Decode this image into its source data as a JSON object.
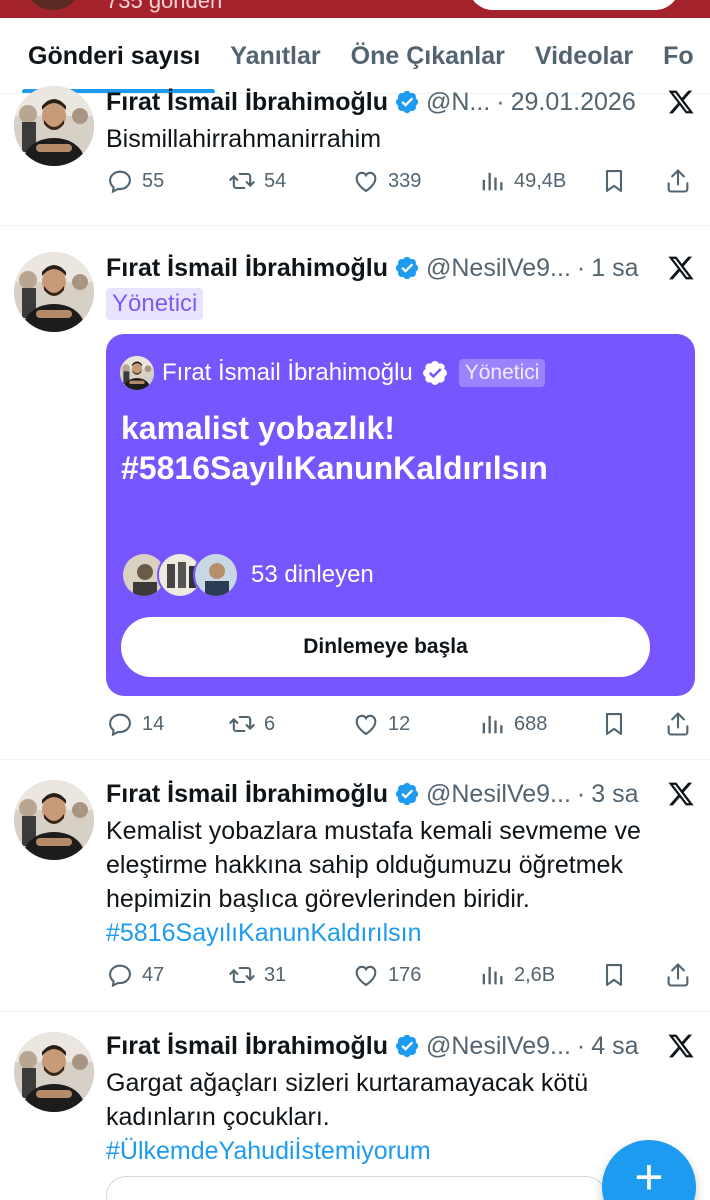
{
  "profile_header": {
    "post_count_partial": "735 gönderi"
  },
  "tabs": [
    {
      "label": "Gönderi sayısı",
      "active": true
    },
    {
      "label": "Yanıtlar",
      "active": false
    },
    {
      "label": "Öne Çıkanlar",
      "active": false
    },
    {
      "label": "Videolar",
      "active": false
    },
    {
      "label": "Fo",
      "active": false
    }
  ],
  "tweets": [
    {
      "name": "Fırat İsmail İbrahimoğlu",
      "handle": "@N...",
      "time": "29.01.2026",
      "text": "Bismillahirrahmanirrahim",
      "replies": "55",
      "retweets": "54",
      "likes": "339",
      "views": "49,4B"
    },
    {
      "name": "Fırat İsmail İbrahimoğlu",
      "handle": "@NesilVe9...",
      "time": "1 sa",
      "role": "Yönetici",
      "space": {
        "host_name": "Fırat İsmail İbrahimoğlu",
        "host_role": "Yönetici",
        "title_line1": "kamalist yobazlık!",
        "title_line2": "#5816SayılıKanunKaldırılsın",
        "listeners": "53 dinleyen",
        "button": "Dinlemeye başla",
        "color": "#7856ff"
      },
      "replies": "14",
      "retweets": "6",
      "likes": "12",
      "views": "688"
    },
    {
      "name": "Fırat İsmail İbrahimoğlu",
      "handle": "@NesilVe9...",
      "time": "3 sa",
      "text_line1": "Kemalist yobazlara mustafa kemali sevmeme ve",
      "text_line2": "eleştirme hakkına sahip olduğumuzu öğretmek",
      "text_line3": "hepimizin başlıca görevlerinden biridir.",
      "hashtag": "#5816SayılıKanunKaldırılsın",
      "replies": "47",
      "retweets": "31",
      "likes": "176",
      "views": "2,6B"
    },
    {
      "name": "Fırat İsmail İbrahimoğlu",
      "handle": "@NesilVe9...",
      "time": "4 sa",
      "text_line1": "Gargat ağaçları sizleri kurtaramayacak kötü",
      "text_line2": "kadınların çocukları.",
      "hashtag": "#ÜlkemdeYahudiİstemiyorum"
    }
  ],
  "colors": {
    "accent": "#1d9bf0",
    "space_purple": "#7856ff",
    "secondary_text": "#536471",
    "role_badge_bg": "#e9e3ff"
  },
  "icons": [
    "reply-icon",
    "retweet-icon",
    "like-icon",
    "views-icon",
    "bookmark-icon",
    "share-icon",
    "verified-icon",
    "x-logo-icon",
    "compose-plus-icon"
  ]
}
